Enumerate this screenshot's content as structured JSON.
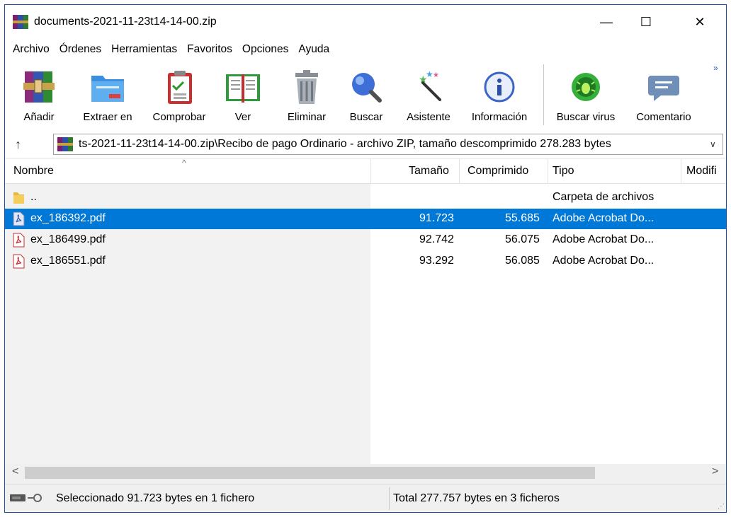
{
  "window": {
    "title": "documents-2021-11-23t14-14-00.zip",
    "minimize": "—",
    "maximize": "☐",
    "close": "✕"
  },
  "menu": [
    "Archivo",
    "Órdenes",
    "Herramientas",
    "Favoritos",
    "Opciones",
    "Ayuda"
  ],
  "toolbar": {
    "buttons": [
      {
        "label": "Añadir",
        "icon": "add-archive-icon"
      },
      {
        "label": "Extraer en",
        "icon": "extract-folder-icon"
      },
      {
        "label": "Comprobar",
        "icon": "test-clipboard-icon"
      },
      {
        "label": "Ver",
        "icon": "view-book-icon"
      },
      {
        "label": "Eliminar",
        "icon": "trash-icon"
      },
      {
        "label": "Buscar",
        "icon": "magnifier-icon"
      },
      {
        "label": "Asistente",
        "icon": "wizard-wand-icon"
      },
      {
        "label": "Información",
        "icon": "info-icon"
      },
      {
        "label": "Buscar virus",
        "icon": "virus-scan-icon"
      },
      {
        "label": "Comentario",
        "icon": "comment-icon"
      }
    ],
    "more": "»"
  },
  "address": {
    "up": "↑",
    "path": "ts-2021-11-23t14-14-00.zip\\Recibo de pago Ordinario - archivo ZIP, tamaño descomprimido 278.283 bytes",
    "dropdown": "∨"
  },
  "columns": {
    "name": "Nombre",
    "size": "Tamaño",
    "packed": "Comprimido",
    "type": "Tipo",
    "modified": "Modifi"
  },
  "rows": [
    {
      "name": "..",
      "size": "",
      "packed": "",
      "type": "Carpeta de archivos",
      "icon": "folder-icon"
    },
    {
      "name": "ex_186392.pdf",
      "size": "91.723",
      "packed": "55.685",
      "type": "Adobe Acrobat Do...",
      "icon": "pdf-icon"
    },
    {
      "name": "ex_186499.pdf",
      "size": "92.742",
      "packed": "56.075",
      "type": "Adobe Acrobat Do...",
      "icon": "pdf-icon"
    },
    {
      "name": "ex_186551.pdf",
      "size": "93.292",
      "packed": "56.085",
      "type": "Adobe Acrobat Do...",
      "icon": "pdf-icon"
    }
  ],
  "selected_row": 1,
  "status": {
    "left": "Seleccionado 91.723 bytes en 1 fichero",
    "right": "Total 277.757 bytes en 3 ficheros"
  },
  "colors": {
    "selection": "#0078d7",
    "window_border": "#1f4e9e"
  }
}
